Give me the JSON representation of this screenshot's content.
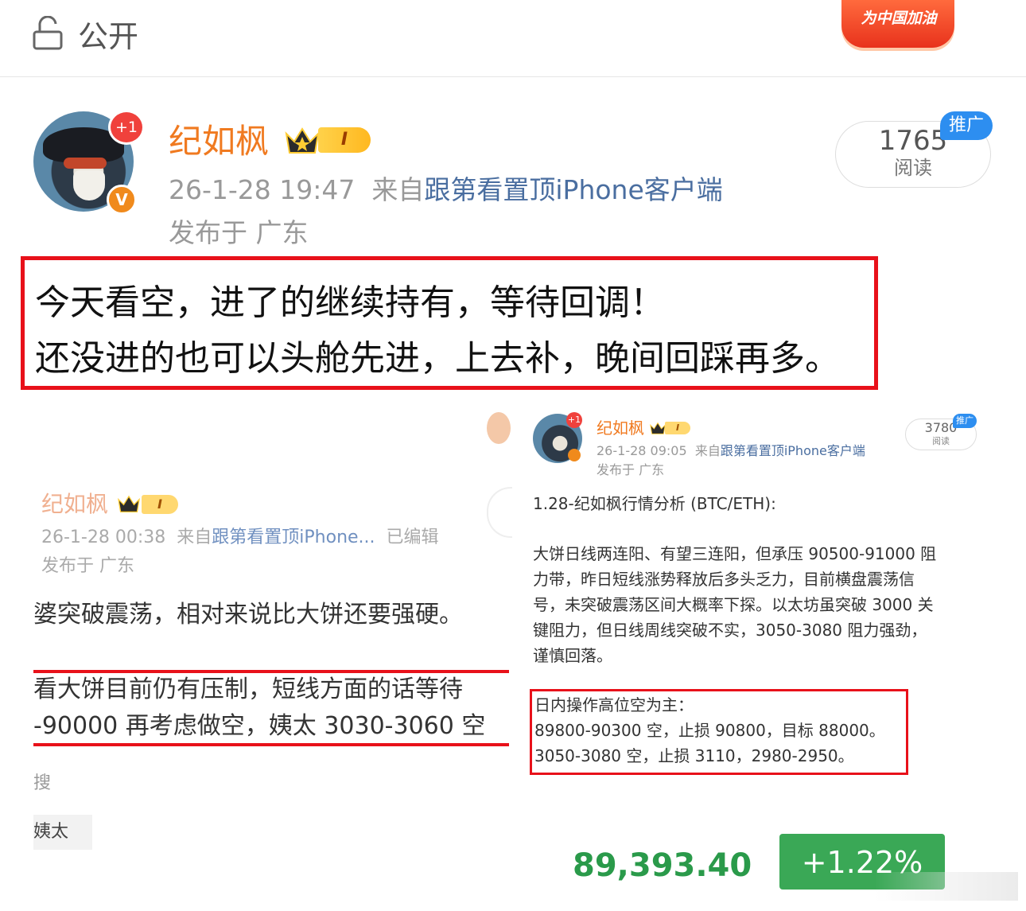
{
  "topbar": {
    "visibility_icon": "lock-icon",
    "visibility_label": "公开",
    "cheer_badge": "为中国加油"
  },
  "post": {
    "notif_badge": "+1",
    "verified_mark": "V",
    "username": "纪如枫",
    "vip_level": "I",
    "time": "26-1-28 19:47",
    "from_prefix": "来自",
    "source": "跟第看置顶iPhone客户端",
    "location": "发布于 广东",
    "read_count": "1765",
    "read_label": "阅读",
    "promo_tag": "推广",
    "text_line1": "今天看空，进了的继续持有，等待回调！",
    "text_line2": "还没进的也可以头舱先进，上去补，晚间回踩再多。"
  },
  "left_shot": {
    "username": "纪如枫",
    "vip_level": "I",
    "time": "26-1-28 00:38",
    "from_prefix": "来自",
    "source": "跟第看置顶iPhone...",
    "edited": "已编辑",
    "location": "发布于 广东",
    "text1": "婆突破震荡，相对来说比大饼还要强硬。",
    "text2": "看大饼目前仍有压制，短线方面的话等待",
    "text3": "-90000 再考虑做空，姨太 3030-3060 空",
    "search": "搜",
    "tag": "姨太"
  },
  "right_shot": {
    "notif_badge": "+1",
    "username": "纪如枫",
    "vip_level": "I",
    "time": "26-1-28 09:05",
    "from_prefix": "来自",
    "source": "跟第看置顶iPhone客户端",
    "location": "发布于 广东",
    "read_count": "3780",
    "read_label": "阅读",
    "promo_tag": "推广",
    "title": "1.28-纪如枫行情分析 (BTC/ETH):",
    "para": [
      "大饼日线两连阳、有望三连阳，但承压 90500-91000 阻",
      "力带，昨日短线涨势释放后多头乏力，目前横盘震荡信",
      "号，未突破震荡区间大概率下探。以太坊虽突破 3000 关",
      "键阻力，但日线周线突破不实，3050-3080 阻力强劲，",
      "谨慎回落。"
    ],
    "ops": [
      "日内操作高位空为主：",
      "89800-90300 空，止损 90800，目标 88000。",
      "3050-3080 空，止损 3110，2980-2950。"
    ],
    "price": "89,393.40",
    "change": "+1.22%"
  }
}
